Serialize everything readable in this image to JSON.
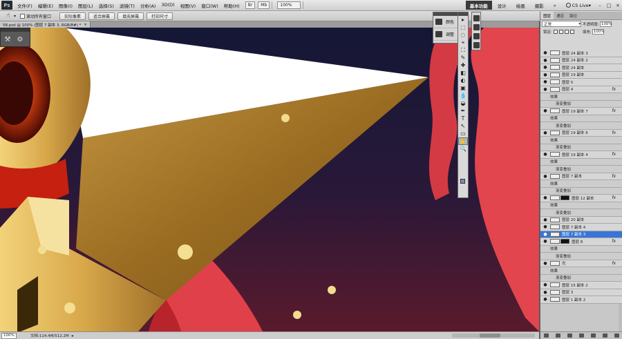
{
  "menubar": {
    "logo": "Ps",
    "menus": [
      "文件(F)",
      "编辑(E)",
      "图像(I)",
      "图层(L)",
      "选择(S)",
      "滤镜(T)",
      "分析(A)",
      "3D(D)",
      "视图(V)",
      "窗口(W)",
      "帮助(H)"
    ],
    "mode_br": "Br",
    "mode_mb": "Mb",
    "zoom": "100%",
    "workspaces": [
      "基本功能",
      "设计",
      "绘画",
      "摄影"
    ],
    "more": "»",
    "cs_live": "CS Live▾",
    "win_min": "–",
    "win_max": "□",
    "win_close": "×"
  },
  "options": {
    "scroll_all_label": "滚动所有窗口",
    "buttons": [
      "实际像素",
      "适合屏幕",
      "填充屏幕",
      "打印尺寸"
    ]
  },
  "document": {
    "tab_title": "58.psd @ 100% (图层 7 副本 3, RGB/8#) *",
    "tab_close": "×"
  },
  "status": {
    "zoom": "100%",
    "doc_size": "文档:114.4M/512.2M"
  },
  "adjustments": {
    "items": [
      "颜色",
      "调整"
    ]
  },
  "tools": {
    "icons": [
      "▸",
      "⬚",
      "◌",
      "⌖",
      "⛶",
      "✎",
      "✚",
      "◧",
      "◐",
      "▣",
      "💧",
      "◒",
      "✒",
      "T",
      "↖",
      "▭",
      "✋",
      "🔍"
    ]
  },
  "layers_panel": {
    "tabs": [
      "图层",
      "通道",
      "路径"
    ],
    "blend_mode": "正常",
    "opacity_label": "不透明度:",
    "opacity": "100%",
    "lock_label": "锁定:",
    "fill_label": "填充:",
    "fill": "100%",
    "fx_label": "fx",
    "effects_label": "效果",
    "gradient_overlay_label": "渐变叠加",
    "layers": [
      {
        "name": "图层 24 副本 3",
        "fx": false,
        "kind": "layer"
      },
      {
        "name": "图层 24 副本 2",
        "fx": false,
        "kind": "layer"
      },
      {
        "name": "图层 24 副本",
        "fx": false,
        "kind": "layer"
      },
      {
        "name": "图层 19 副本",
        "fx": false,
        "kind": "layer"
      },
      {
        "name": "图层 5",
        "fx": false,
        "kind": "layer"
      },
      {
        "name": "图层 4",
        "fx": true,
        "kind": "layer"
      },
      {
        "name": "效果",
        "kind": "effects"
      },
      {
        "name": "渐变叠加",
        "kind": "effect"
      },
      {
        "name": "图层 19 副本 7",
        "fx": true,
        "kind": "layer"
      },
      {
        "name": "效果",
        "kind": "effects"
      },
      {
        "name": "渐变叠加",
        "kind": "effect"
      },
      {
        "name": "图层 19 副本 6",
        "fx": true,
        "kind": "layer"
      },
      {
        "name": "效果",
        "kind": "effects"
      },
      {
        "name": "渐变叠加",
        "kind": "effect"
      },
      {
        "name": "图层 19 副本 4",
        "fx": true,
        "kind": "layer"
      },
      {
        "name": "效果",
        "kind": "effects"
      },
      {
        "name": "渐变叠加",
        "kind": "effect"
      },
      {
        "name": "图层 7 副本",
        "fx": true,
        "kind": "layer"
      },
      {
        "name": "效果",
        "kind": "effects"
      },
      {
        "name": "渐变叠加",
        "kind": "effect"
      },
      {
        "name": "图层 12 副本",
        "fx": true,
        "kind": "layer",
        "mask": true
      },
      {
        "name": "效果",
        "kind": "effects"
      },
      {
        "name": "渐变叠加",
        "kind": "effect"
      },
      {
        "name": "图层 20 副本",
        "fx": false,
        "kind": "layer"
      },
      {
        "name": "图层 7 副本 4",
        "fx": false,
        "kind": "layer"
      },
      {
        "name": "图层 7 副本 3",
        "fx": false,
        "kind": "layer",
        "selected": true
      },
      {
        "name": "图层 8",
        "fx": true,
        "kind": "layer",
        "mask": true
      },
      {
        "name": "效果",
        "kind": "effects"
      },
      {
        "name": "渐变叠加",
        "kind": "effect"
      },
      {
        "name": "光",
        "fx": true,
        "kind": "layer"
      },
      {
        "name": "效果",
        "kind": "effects"
      },
      {
        "name": "渐变叠加",
        "kind": "effect"
      },
      {
        "name": "图层 15 副本 2",
        "fx": false,
        "kind": "layer"
      },
      {
        "name": "图层 3",
        "fx": false,
        "kind": "layer"
      },
      {
        "name": "图层 1 副本 2",
        "fx": false,
        "kind": "layer"
      }
    ]
  },
  "colors": {
    "selection": "#3875d7",
    "foreground_swatch": "#8b86b8",
    "artwork_bg_top": "#1a1a3a",
    "artwork_bg_bottom": "#4a1a2e",
    "artwork_red": "#e8404a",
    "artwork_gold": "#b8862a"
  }
}
